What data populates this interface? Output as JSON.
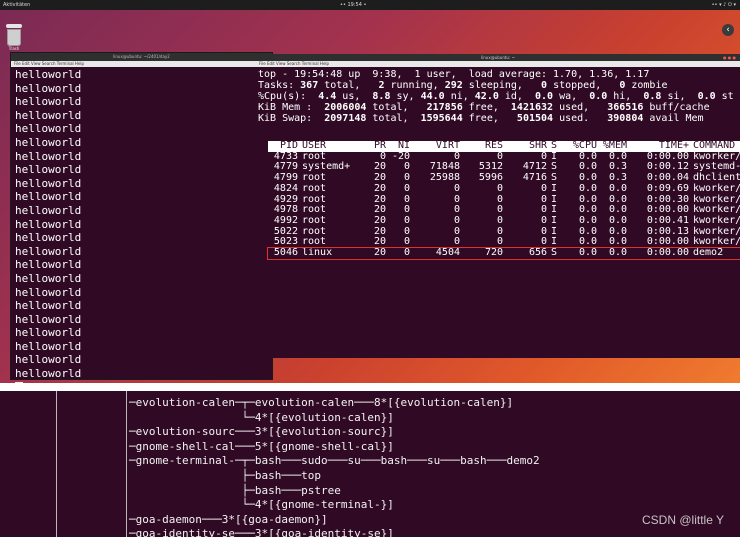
{
  "topbar": {
    "activities": "Aktivitäten",
    "clock": "•• 19:54 •",
    "tray": "•• ▾  ♪ ⏻ ▾"
  },
  "desktop": {
    "trash_label": "Trash",
    "back_glyph": "‹"
  },
  "left_terminal": {
    "title": "linux@ubuntu: ~/2401/day2",
    "menu": "File  Edit  View  Search  Terminal  Help",
    "lines": [
      "helloworld",
      "helloworld",
      "helloworld",
      "helloworld",
      "helloworld",
      "helloworld",
      "helloworld",
      "helloworld",
      "helloworld",
      "helloworld",
      "helloworld",
      "helloworld",
      "helloworld",
      "helloworld",
      "helloworld",
      "helloworld",
      "helloworld",
      "helloworld",
      "helloworld",
      "helloworld",
      "helloworld",
      "helloworld",
      "helloworld"
    ]
  },
  "right_terminal": {
    "title": "linux@ubuntu: ~",
    "menu": "File  Edit  View  Search  Terminal  Help",
    "header": {
      "l1": "top - 19:54:48 up  9:38,  1 user,  load average: 1.70, 1.36, 1.17",
      "l2a": "Tasks: ",
      "l2b": "367",
      "l2c": " total,   ",
      "l2d": "2",
      "l2e": " running, ",
      "l2f": "292",
      "l2g": " sleeping,   ",
      "l2h": "0",
      "l2i": " stopped,   ",
      "l2j": "0",
      "l2k": " zombie",
      "l3a": "%Cpu(s):  ",
      "l3b": "4.4",
      "l3c": " us,  ",
      "l3d": "8.8",
      "l3e": " sy, ",
      "l3f": "44.0",
      "l3g": " ni, ",
      "l3h": "42.0",
      "l3i": " id,  ",
      "l3j": "0.0",
      "l3k": " wa,  ",
      "l3l": "0.0",
      "l3m": " hi,  ",
      "l3n": "0.8",
      "l3o": " si,  ",
      "l3p": "0.0",
      "l3q": " st",
      "l4a": "KiB Mem :  ",
      "l4b": "2006004",
      "l4c": " total,   ",
      "l4d": "217856",
      "l4e": " free,  ",
      "l4f": "1421632",
      "l4g": " used,   ",
      "l4h": "366516",
      "l4i": " buff/cache",
      "l5a": "KiB Swap:  ",
      "l5b": "2097148",
      "l5c": " total,  ",
      "l5d": "1595644",
      "l5e": " free,   ",
      "l5f": "501504",
      "l5g": " used.   ",
      "l5h": "390804",
      "l5i": " avail Mem"
    },
    "columns": [
      "PID",
      "USER",
      "PR",
      "NI",
      "VIRT",
      "RES",
      "SHR",
      "S",
      "%CPU",
      "%MEM",
      "TIME+",
      "COMMAND"
    ],
    "rows": [
      [
        "4733",
        "root",
        "0",
        "-20",
        "0",
        "0",
        "0",
        "I",
        "0.0",
        "0.0",
        "0:00.00",
        "kworker/u+"
      ],
      [
        "4779",
        "systemd+",
        "20",
        "0",
        "71848",
        "5312",
        "4712",
        "S",
        "0.0",
        "0.3",
        "0:00.12",
        "systemd-n+"
      ],
      [
        "4799",
        "root",
        "20",
        "0",
        "25988",
        "5996",
        "4716",
        "S",
        "0.0",
        "0.3",
        "0:00.04",
        "dhclient"
      ],
      [
        "4824",
        "root",
        "20",
        "0",
        "0",
        "0",
        "0",
        "I",
        "0.0",
        "0.0",
        "0:09.69",
        "kworker/0+"
      ],
      [
        "4929",
        "root",
        "20",
        "0",
        "0",
        "0",
        "0",
        "I",
        "0.0",
        "0.0",
        "0:00.30",
        "kworker/0+"
      ],
      [
        "4978",
        "root",
        "20",
        "0",
        "0",
        "0",
        "0",
        "I",
        "0.0",
        "0.0",
        "0:00.00",
        "kworker/0+"
      ],
      [
        "4992",
        "root",
        "20",
        "0",
        "0",
        "0",
        "0",
        "I",
        "0.0",
        "0.0",
        "0:00.41",
        "kworker/1+"
      ],
      [
        "5022",
        "root",
        "20",
        "0",
        "0",
        "0",
        "0",
        "I",
        "0.0",
        "0.0",
        "0:00.13",
        "kworker/0+"
      ],
      [
        "5023",
        "root",
        "20",
        "0",
        "0",
        "0",
        "0",
        "I",
        "0.0",
        "0.0",
        "0:00.00",
        "kworker/1+"
      ],
      [
        "5046",
        "linux",
        "20",
        "0",
        "4504",
        "720",
        "656",
        "S",
        "0.0",
        "0.0",
        "0:00.00",
        "demo2"
      ]
    ],
    "highlight_row": 9
  },
  "pstree": {
    "lines": [
      "─evolution-calen─┬─evolution-calen───8*[{evolution-calen}]",
      "                 └─4*[{evolution-calen}]",
      "─evolution-sourc───3*[{evolution-sourc}]",
      "─gnome-shell-cal───5*[{gnome-shell-cal}]",
      "─gnome-terminal-─┬─bash───sudo───su───bash───su───bash───demo2",
      "                 ├─bash───top",
      "                 ├─bash───pstree",
      "                 └─4*[{gnome-terminal-}]",
      "─goa-daemon───3*[{goa-daemon}]",
      "─goa-identity-se───3*[{goa-identity-se}]"
    ],
    "watermark": "CSDN @little Y"
  },
  "colors": {
    "terminal_bg": "#300a24",
    "highlight_border": "#e03030"
  }
}
